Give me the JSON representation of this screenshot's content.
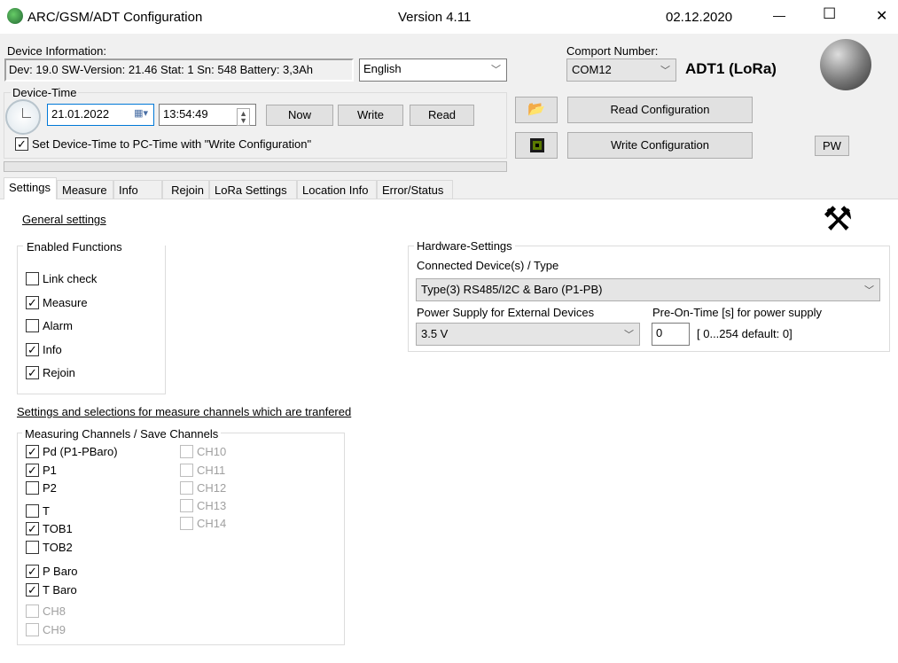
{
  "window": {
    "title": "ARC/GSM/ADT Configuration",
    "version": "Version 4.11",
    "date": "02.12.2020",
    "minimize": "—",
    "maximize": "☐",
    "close": "✕"
  },
  "device_info": {
    "label": "Device Information:",
    "value": "Dev: 19.0 SW-Version: 21.46 Stat: 1 Sn: 548 Battery: 3,3Ah",
    "language": "English"
  },
  "device_time": {
    "label": "Device-Time",
    "date": "21.01.2022",
    "time": "13:54:49",
    "now": "Now",
    "write": "Write",
    "read": "Read",
    "sync_label": "Set Device-Time to PC-Time with \"Write Configuration\"",
    "sync_checked": true
  },
  "comport": {
    "label": "Comport Number:",
    "value": "COM12",
    "device": "ADT1 (LoRa)"
  },
  "actions": {
    "read_config": "Read Configuration",
    "write_config": "Write Configuration",
    "pw": "PW"
  },
  "tabs": [
    {
      "label": "Settings",
      "selected": true
    },
    {
      "label": "Measure"
    },
    {
      "label": "Info"
    },
    {
      "label": "Rejoin"
    },
    {
      "label": "LoRa Settings"
    },
    {
      "label": "Location Info"
    },
    {
      "label": "Error/Status"
    }
  ],
  "settings": {
    "general_title": "General settings",
    "enabled_functions": {
      "label": "Enabled Functions",
      "items": [
        {
          "label": "Link check",
          "checked": false
        },
        {
          "label": "Measure",
          "checked": true
        },
        {
          "label": "Alarm",
          "checked": false
        },
        {
          "label": "Info",
          "checked": true
        },
        {
          "label": "Rejoin",
          "checked": true
        }
      ]
    },
    "hardware": {
      "label": "Hardware-Settings",
      "connected_label": "Connected Device(s) / Type",
      "connected_value": "Type(3)  RS485/I2C & Baro (P1-PB)",
      "power_label": "Power Supply for External Devices",
      "power_value": "3.5 V",
      "preon_label": "Pre-On-Time [s] for power supply",
      "preon_value": "0",
      "preon_hint": "[ 0...254   default: 0]"
    },
    "channels_title": "Settings and selections for measure channels which are tranfered",
    "channels": {
      "label": "Measuring Channels / Save Channels",
      "col1": [
        {
          "label": "Pd (P1-PBaro)",
          "checked": true
        },
        {
          "label": "P1",
          "checked": true
        },
        {
          "label": "P2",
          "checked": false
        },
        {
          "label": "T",
          "checked": false
        },
        {
          "label": "TOB1",
          "checked": true
        },
        {
          "label": "TOB2",
          "checked": false
        },
        {
          "label": "P Baro",
          "checked": true
        },
        {
          "label": "T Baro",
          "checked": true
        },
        {
          "label": "CH8",
          "checked": false,
          "disabled": true
        },
        {
          "label": "CH9",
          "checked": false,
          "disabled": true
        }
      ],
      "col2": [
        {
          "label": "CH10",
          "disabled": true
        },
        {
          "label": "CH11",
          "disabled": true
        },
        {
          "label": "CH12",
          "disabled": true
        },
        {
          "label": "CH13",
          "disabled": true
        },
        {
          "label": "CH14",
          "disabled": true
        }
      ]
    }
  }
}
